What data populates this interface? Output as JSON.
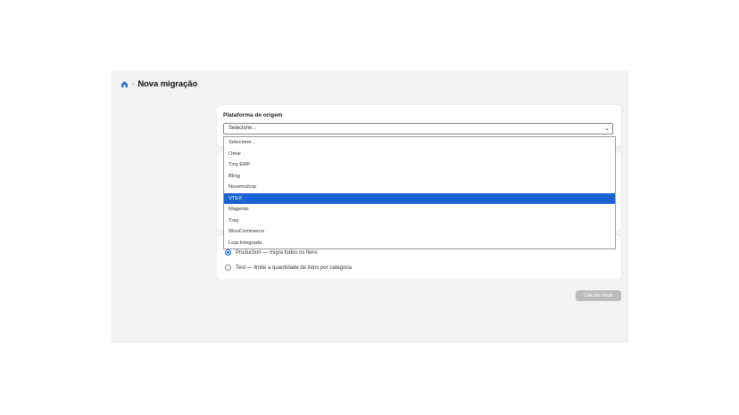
{
  "breadcrumb": {
    "separator": "›",
    "title": "Nova migração"
  },
  "platform": {
    "label": "Plataforma de origem",
    "selected": "Selecione...",
    "options": [
      "Selecione...",
      "Omie",
      "Tiny ERP",
      "Bling",
      "Nuvemshop",
      "VTEX",
      "Magento",
      "Tray",
      "WooCommerce",
      "Loja Integrada"
    ],
    "highlighted": "VTEX"
  },
  "mode": {
    "production": "Production — migra todos os itens",
    "test": "Test — limite a quantidade de itens por categoria"
  },
  "actions": {
    "calculate": "Calcular totais"
  },
  "colors": {
    "accent": "#1a63d6",
    "background": "#f2f2f2",
    "disabled_button": "#bcbcbc"
  }
}
